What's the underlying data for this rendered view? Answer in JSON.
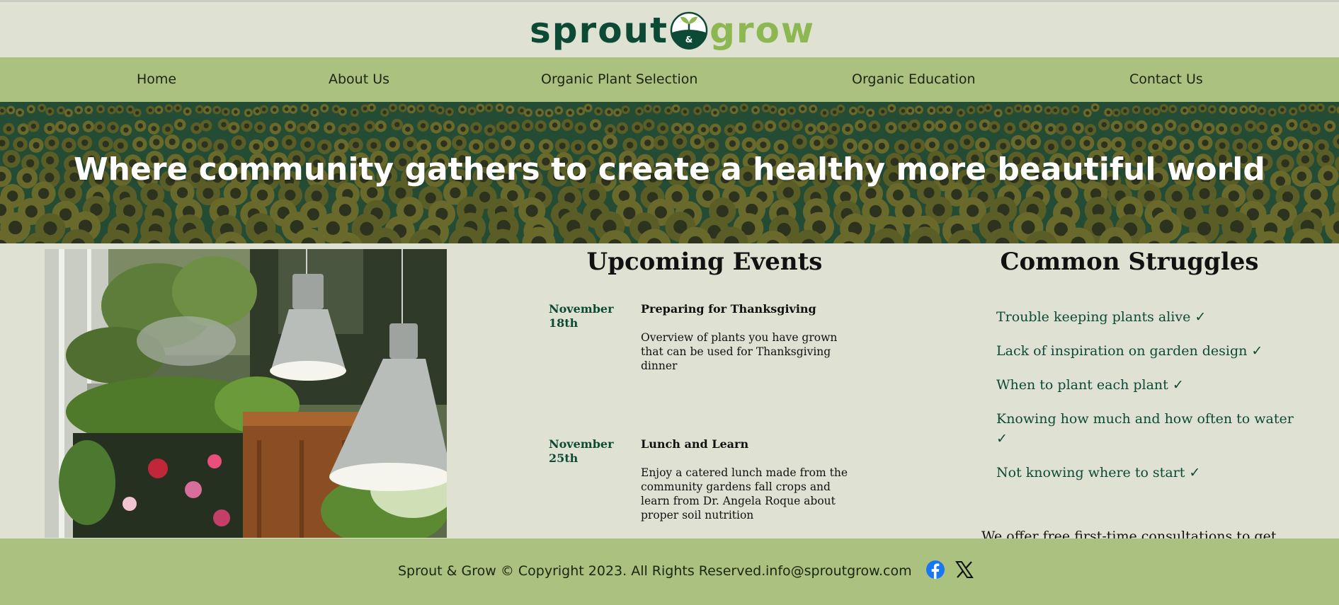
{
  "logo": {
    "part1": "sprout",
    "part2": "grow",
    "mark_glyph": "&"
  },
  "nav": {
    "items": [
      {
        "label": "Home"
      },
      {
        "label": "About Us"
      },
      {
        "label": "Organic Plant Selection"
      },
      {
        "label": "Organic Education"
      },
      {
        "label": "Contact Us"
      }
    ]
  },
  "hero": {
    "title": "Where community gathers to create a healthy more beautiful world"
  },
  "events": {
    "title": "Upcoming Events",
    "items": [
      {
        "date": "November 18th",
        "name": "Preparing for Thanksgiving",
        "description": "Overview of plants you have grown that can be used for Thanksgiving dinner"
      },
      {
        "date": "November 25th",
        "name": "Lunch and Learn",
        "description": "Enjoy a catered lunch made from the community gardens fall crops and learn from Dr. Angela Roque about proper soil nutrition"
      }
    ]
  },
  "struggles": {
    "title": "Common Struggles",
    "items": [
      "Trouble keeping plants alive ✓",
      "Lack of inspiration on garden design ✓",
      "When to plant each plant ✓",
      "Knowing how much and how often to water ✓",
      "Not knowing where to start ✓"
    ],
    "consult": "We offer free first-time consultations to get"
  },
  "footer": {
    "copyright": "Sprout & Grow © Copyright 2023. All Rights Reserved.",
    "email": "info@sproutgrow.com",
    "social": [
      {
        "icon": "facebook-icon"
      },
      {
        "icon": "x-icon"
      }
    ]
  },
  "colors": {
    "background": "#dfe1d2",
    "nav_green": "#aac17f",
    "brand_dark_green": "#0d4a35",
    "brand_light_green": "#8db750",
    "facebook_blue": "#1877f2"
  }
}
